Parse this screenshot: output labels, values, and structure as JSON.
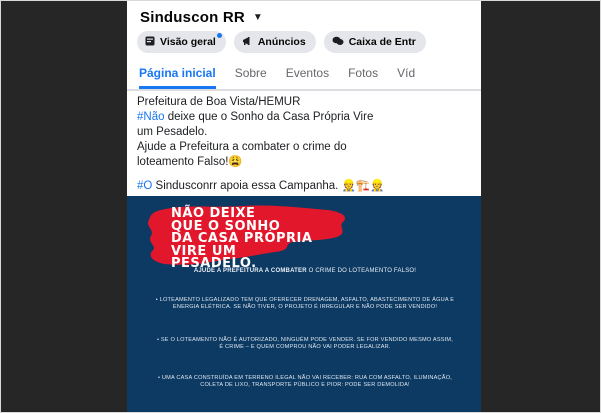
{
  "page": {
    "name": "Sinduscon RR",
    "chips": [
      {
        "label": "Visão geral",
        "icon": "overview-icon"
      },
      {
        "label": "Anúncios",
        "icon": "megaphone-icon"
      },
      {
        "label": "Caixa de Entr",
        "icon": "inbox-chat-icon"
      }
    ],
    "tabs": [
      "Página inicial",
      "Sobre",
      "Eventos",
      "Fotos",
      "Víd"
    ]
  },
  "post": {
    "line1": "Prefeitura de Boa Vista/HEMUR",
    "hashtag1": "#Não",
    "line2_rest": " deixe que o Sonho da Casa Própria  Vire",
    "line3": "um Pesadelo.",
    "line4": "Ajude a Prefeitura a combater o crime do",
    "line5": "loteamento Falso!",
    "emoji1": "😩",
    "hashtag2": "#O",
    "line6_rest": " Sindusconrr apoia essa Campanha. ",
    "emoji2": "👷🏗️👷"
  },
  "poster": {
    "headline": [
      "NÃO DEIXE",
      "QUE O SONHO",
      "DA CASA PRÓPRIA",
      "VIRE UM",
      "PESADELO."
    ],
    "lead_bold": "AJUDE A PREFEITURA A COMBATER",
    "lead_rest": " O CRIME DO LOTEAMENTO FALSO!",
    "bullets": [
      "• LOTEAMENTO LEGALIZADO TEM QUE OFERECER DRENAGEM, ASFALTO, ABASTECIMENTO DE ÁGUA E ENERGIA ELÉTRICA. SE NÃO TIVER, O PROJETO É IRREGULAR E NÃO PODE SER VENDIDO!",
      "• SE O LOTEAMENTO NÃO É AUTORIZADO, NINGUÉM PODE VENDER. SE FOR VENDIDO MESMO ASSIM, É CRIME – E QUEM COMPROU NÃO VAI PODER LEGALIZAR.",
      "• UMA CASA CONSTRUÍDA EM TERRENO ILEGAL NÃO VAI RECEBER: RUA COM ASFALTO, ILUMINAÇÃO, COLETA DE LIXO, TRANSPORTE PÚBLICO E PIOR: PODE SER DEMOLIDA!"
    ]
  },
  "colors": {
    "brand_blue": "#1877f2",
    "poster_bg": "#0d3a63",
    "splash_red": "#e3172b",
    "chip_bg": "#e4e6eb"
  }
}
